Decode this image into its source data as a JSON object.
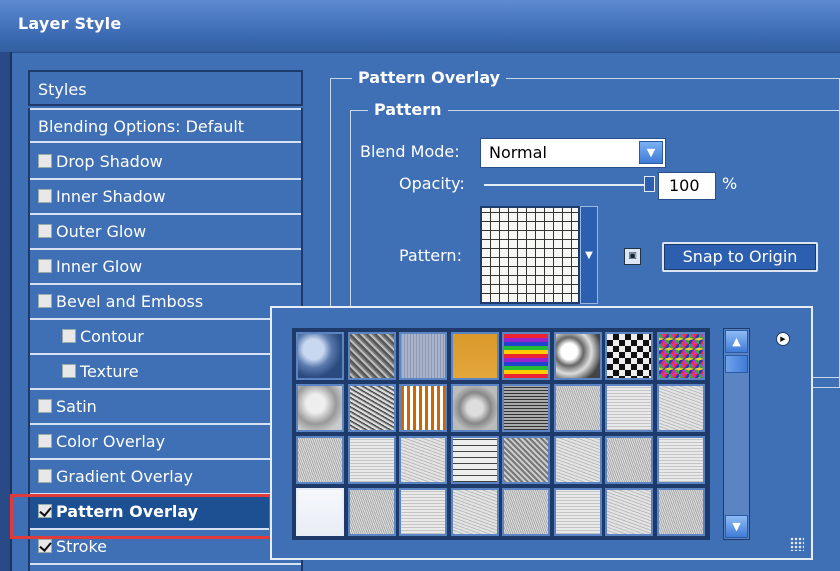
{
  "window": {
    "title": "Layer Style"
  },
  "styles": {
    "header": "Styles",
    "items": [
      {
        "label": "Blending Options: Default",
        "checkbox": false,
        "checked": false,
        "indent": 0
      },
      {
        "label": "Drop Shadow",
        "checkbox": true,
        "checked": false,
        "indent": 0
      },
      {
        "label": "Inner Shadow",
        "checkbox": true,
        "checked": false,
        "indent": 0
      },
      {
        "label": "Outer Glow",
        "checkbox": true,
        "checked": false,
        "indent": 0
      },
      {
        "label": "Inner Glow",
        "checkbox": true,
        "checked": false,
        "indent": 0
      },
      {
        "label": "Bevel and Emboss",
        "checkbox": true,
        "checked": false,
        "indent": 0
      },
      {
        "label": "Contour",
        "checkbox": true,
        "checked": false,
        "indent": 1
      },
      {
        "label": "Texture",
        "checkbox": true,
        "checked": false,
        "indent": 1
      },
      {
        "label": "Satin",
        "checkbox": true,
        "checked": false,
        "indent": 0
      },
      {
        "label": "Color Overlay",
        "checkbox": true,
        "checked": false,
        "indent": 0
      },
      {
        "label": "Gradient Overlay",
        "checkbox": true,
        "checked": false,
        "indent": 0
      },
      {
        "label": "Pattern Overlay",
        "checkbox": true,
        "checked": true,
        "indent": 0,
        "selected": true
      },
      {
        "label": "Stroke",
        "checkbox": true,
        "checked": true,
        "indent": 0
      }
    ]
  },
  "pattern_overlay": {
    "group_title": "Pattern Overlay",
    "subgroup_title": "Pattern",
    "blend_mode_label": "Blend Mode:",
    "blend_mode_value": "Normal",
    "opacity_label": "Opacity:",
    "opacity_value": "100",
    "opacity_unit": "%",
    "opacity_level": 1.0,
    "pattern_label": "Pattern:",
    "snap_button": "Snap to Origin"
  },
  "pattern_picker": {
    "patterns": [
      "bubbles",
      "wrinkles",
      "fibers",
      "orange-texture",
      "rainbow-stripes",
      "stone",
      "checkerboard",
      "confetti",
      "gray-clouds",
      "granite",
      "arrows",
      "gray-bubbles",
      "mesh",
      "paper-1",
      "paper-2",
      "paper-3",
      "paper-4",
      "granite-2",
      "paper-5",
      "grid",
      "burlap",
      "paper-6",
      "paper-7",
      "paper-8",
      "white",
      "paper-9",
      "paper-10",
      "paper-11",
      "paper-12",
      "paper-13",
      "paper-14",
      "paper-15"
    ],
    "colors": {
      "accent": "#3f6fb4",
      "dark": "#1e3a6a",
      "highlight": "#e03a3a"
    }
  }
}
